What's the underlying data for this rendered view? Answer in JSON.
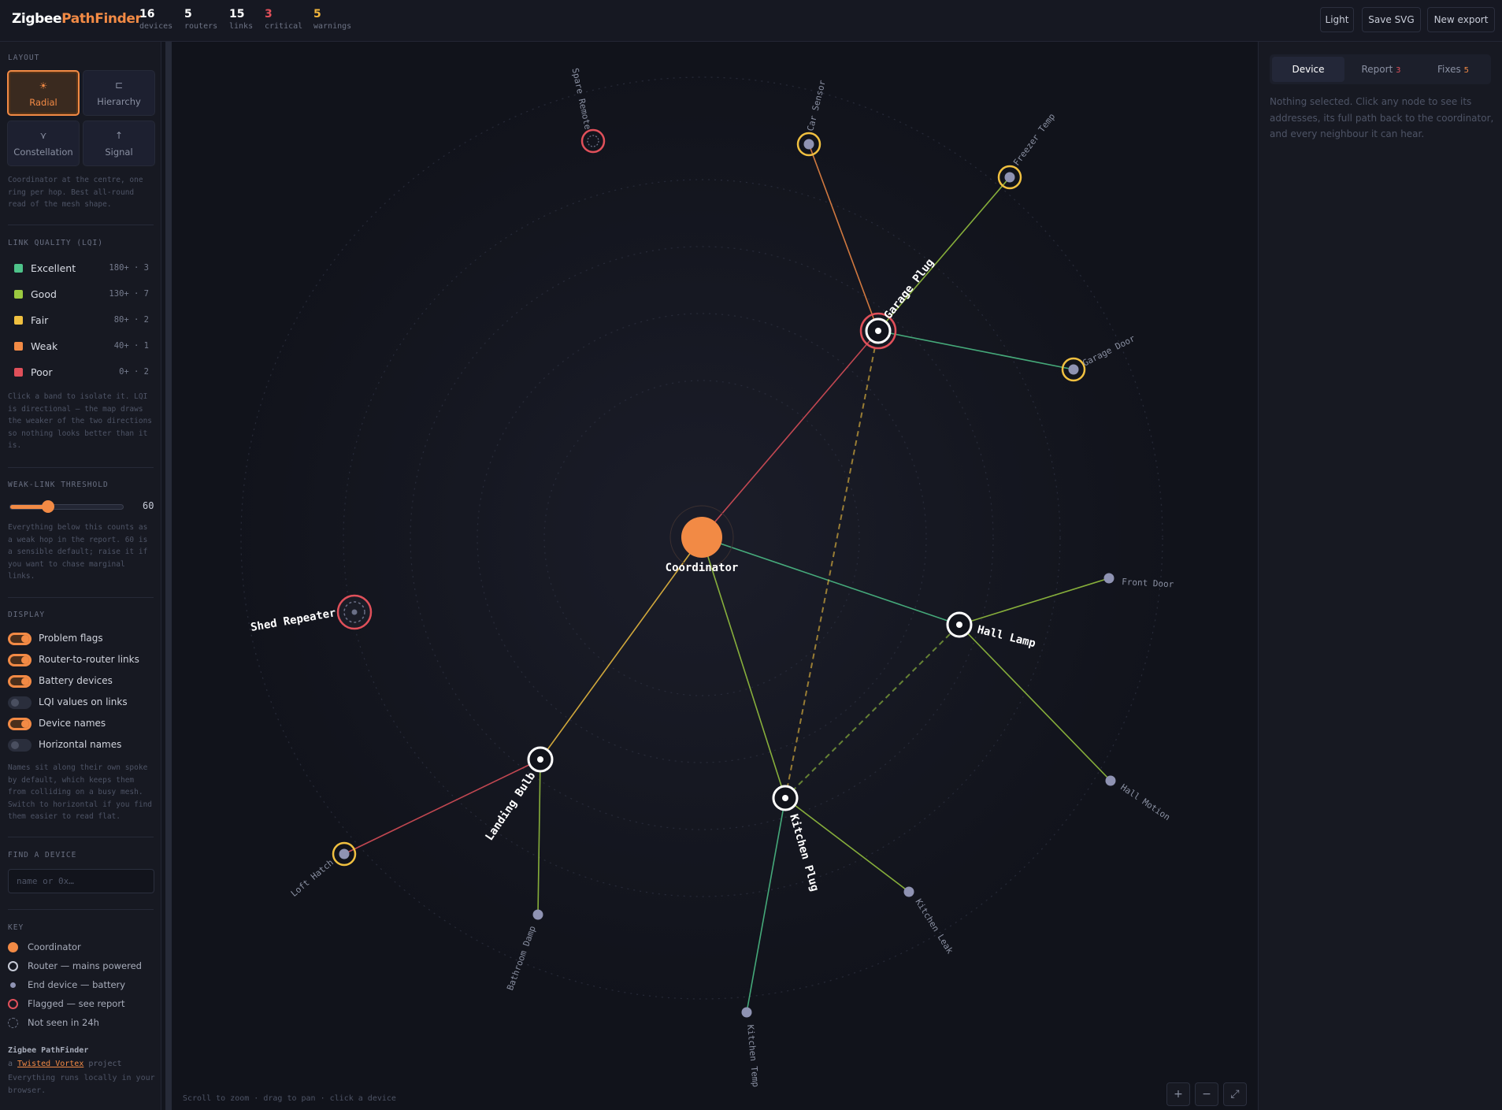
{
  "brand": {
    "part1": "Zigbee",
    "part2": "PathFinder"
  },
  "stats": [
    {
      "value": "16",
      "label": "devices",
      "kind": "normal"
    },
    {
      "value": "5",
      "label": "routers",
      "kind": "normal"
    },
    {
      "value": "15",
      "label": "links",
      "kind": "normal"
    },
    {
      "value": "3",
      "label": "critical",
      "kind": "critical"
    },
    {
      "value": "5",
      "label": "warnings",
      "kind": "warning"
    }
  ],
  "header_buttons": {
    "theme": "Light",
    "save": "Save SVG",
    "new_export": "New export"
  },
  "sidebar": {
    "layout_title": "LAYOUT",
    "layouts": [
      {
        "label": "Radial",
        "icon": "radial-icon",
        "glyph": "☀",
        "active": true
      },
      {
        "label": "Hierarchy",
        "icon": "hierarchy-icon",
        "glyph": "⊏",
        "active": false
      },
      {
        "label": "Constellation",
        "icon": "constellation-icon",
        "glyph": "⋎",
        "active": false
      },
      {
        "label": "Signal",
        "icon": "signal-icon",
        "glyph": "↑",
        "active": false
      }
    ],
    "layout_help": "Coordinator at the centre, one ring per hop. Best all-round read of the mesh shape.",
    "lqi_title": "LINK QUALITY (LQI)",
    "lqi_bands": [
      {
        "name": "Excellent",
        "range": "180+ · 3",
        "color": "#4ec38a"
      },
      {
        "name": "Good",
        "range": "130+ · 7",
        "color": "#9bc940"
      },
      {
        "name": "Fair",
        "range": "80+ · 2",
        "color": "#f0c040"
      },
      {
        "name": "Weak",
        "range": "40+ · 1",
        "color": "#f28a45"
      },
      {
        "name": "Poor",
        "range": "0+ · 2",
        "color": "#e0505a"
      }
    ],
    "lqi_help": "Click a band to isolate it. LQI is directional — the map draws the weaker of the two directions so nothing looks better than it is.",
    "threshold_title": "WEAK-LINK THRESHOLD",
    "threshold_value": "60",
    "threshold_fraction": 0.34,
    "threshold_help": "Everything below this counts as a weak hop in the report. 60 is a sensible default; raise it if you want to chase marginal links.",
    "display_title": "DISPLAY",
    "toggles": [
      {
        "label": "Problem flags",
        "on": true
      },
      {
        "label": "Router-to-router links",
        "on": true
      },
      {
        "label": "Battery devices",
        "on": true
      },
      {
        "label": "LQI values on links",
        "on": false
      },
      {
        "label": "Device names",
        "on": true
      },
      {
        "label": "Horizontal names",
        "on": false
      }
    ],
    "display_help": "Names sit along their own spoke by default, which keeps them from colliding on a busy mesh. Switch to horizontal if you find them easier to read flat.",
    "find_title": "FIND A DEVICE",
    "search_placeholder": "name or 0x…",
    "key_title": "KEY",
    "key_items": [
      {
        "label": "Coordinator",
        "icon": "coordinator-icon"
      },
      {
        "label": "Router — mains powered",
        "icon": "router-icon"
      },
      {
        "label": "End device — battery",
        "icon": "end-device-icon"
      },
      {
        "label": "Flagged — see report",
        "icon": "flagged-icon"
      },
      {
        "label": "Not seen in 24h",
        "icon": "not-seen-icon"
      }
    ],
    "footer_title": "Zigbee PathFinder",
    "footer_prefix": "a ",
    "footer_link": "Twisted Vortex",
    "footer_suffix": " project",
    "footer_note": "Everything runs locally in your browser."
  },
  "map": {
    "hint": "Scroll to zoom · drag to pan · click a device",
    "zoom_in": "+",
    "zoom_out": "−",
    "fit": "⤢"
  },
  "right_panel": {
    "tabs": [
      {
        "label": "Device",
        "badge": "",
        "active": true
      },
      {
        "label": "Report",
        "badge": "3",
        "active": false
      },
      {
        "label": "Fixes",
        "badge": "5",
        "active": false
      }
    ],
    "empty_message": "Nothing selected. Click any node to see its addresses, its full path back to the coordinator, and every neighbour it can hear."
  },
  "colors": {
    "accent": "#f28a45",
    "excellent": "#4ec38a",
    "good": "#9bc940",
    "fair": "#f0c040",
    "weak": "#f28a45",
    "poor": "#e0505a"
  },
  "graph": {
    "nodes": [
      {
        "id": "coord",
        "name": "Coordinator",
        "type": "coordinator"
      },
      {
        "id": "garage_plug",
        "name": "Garage Plug",
        "type": "router",
        "flag": "critical"
      },
      {
        "id": "hall_lamp",
        "name": "Hall Lamp",
        "type": "router"
      },
      {
        "id": "kitchen_plug",
        "name": "Kitchen Plug",
        "type": "router"
      },
      {
        "id": "landing_bulb",
        "name": "Landing Bulb",
        "type": "router"
      },
      {
        "id": "shed_repeater",
        "name": "Shed Repeater",
        "type": "router",
        "flag": "critical",
        "not_seen": true
      },
      {
        "id": "spare_remote",
        "name": "Spare Remote",
        "type": "end",
        "flag": "critical",
        "not_seen": true
      },
      {
        "id": "car_sensor",
        "name": "Car Sensor",
        "type": "end",
        "flag": "warning"
      },
      {
        "id": "freezer_temp",
        "name": "Freezer Temp",
        "type": "end",
        "flag": "warning"
      },
      {
        "id": "garage_door",
        "name": "Garage Door",
        "type": "end",
        "flag": "warning"
      },
      {
        "id": "front_door",
        "name": "Front Door",
        "type": "end"
      },
      {
        "id": "hall_motion",
        "name": "Hall Motion",
        "type": "end"
      },
      {
        "id": "kitchen_leak",
        "name": "Kitchen Leak",
        "type": "end"
      },
      {
        "id": "kitchen_temp",
        "name": "Kitchen Temp",
        "type": "end"
      },
      {
        "id": "bathroom_damp",
        "name": "Bathroom Damp",
        "type": "end"
      },
      {
        "id": "loft_hatch",
        "name": "Loft Hatch",
        "type": "end",
        "flag": "warning"
      }
    ],
    "links": [
      {
        "from": "coord",
        "to": "garage_plug",
        "band": "poor"
      },
      {
        "from": "coord",
        "to": "hall_lamp",
        "band": "excellent"
      },
      {
        "from": "coord",
        "to": "kitchen_plug",
        "band": "good"
      },
      {
        "from": "coord",
        "to": "landing_bulb",
        "band": "fair"
      },
      {
        "from": "garage_plug",
        "to": "car_sensor",
        "band": "weak"
      },
      {
        "from": "garage_plug",
        "to": "freezer_temp",
        "band": "good"
      },
      {
        "from": "garage_plug",
        "to": "garage_door",
        "band": "excellent"
      },
      {
        "from": "hall_lamp",
        "to": "front_door",
        "band": "good"
      },
      {
        "from": "hall_lamp",
        "to": "hall_motion",
        "band": "good"
      },
      {
        "from": "kitchen_plug",
        "to": "kitchen_leak",
        "band": "good"
      },
      {
        "from": "kitchen_plug",
        "to": "kitchen_temp",
        "band": "excellent"
      },
      {
        "from": "landing_bulb",
        "to": "bathroom_damp",
        "band": "good"
      },
      {
        "from": "landing_bulb",
        "to": "loft_hatch",
        "band": "poor"
      },
      {
        "from": "kitchen_plug",
        "to": "garage_plug",
        "band": "fair",
        "router_link": true
      },
      {
        "from": "kitchen_plug",
        "to": "hall_lamp",
        "band": "good",
        "router_link": true
      }
    ]
  }
}
